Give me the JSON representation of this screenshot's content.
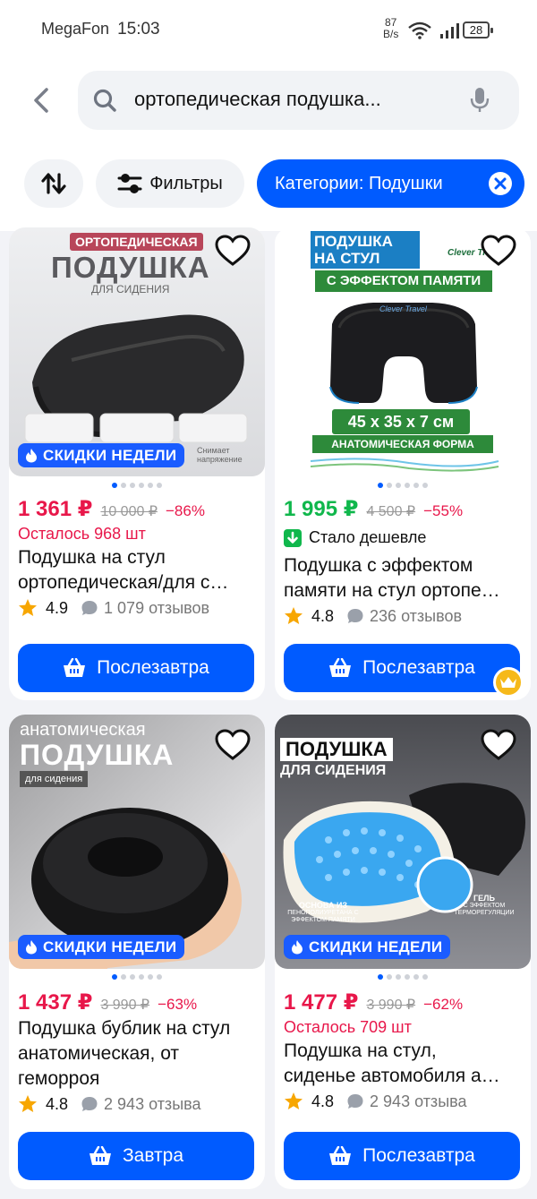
{
  "status_bar": {
    "carrier": "MegaFon",
    "time": "15:03",
    "net_speed_value": "87",
    "net_speed_unit": "B/s",
    "battery": "28"
  },
  "search": {
    "query": "ортопедическая подушка..."
  },
  "chips": {
    "filters_label": "Фильтры",
    "category_label": "Категории: Подушки"
  },
  "colors": {
    "accent": "#005bff",
    "price_red": "#e8174a",
    "price_green": "#10b74c",
    "badge": "#1a5cff"
  },
  "products": [
    {
      "image_text": {
        "top": "ОРТОПЕДИЧЕСКАЯ",
        "main": "ПОДУШКА",
        "sub": "ДЛЯ СИДЕНИЯ",
        "tag": "Снимает напряжение"
      },
      "badge": "СКИДКИ НЕДЕЛИ",
      "price": "1 361 ₽",
      "old_price": "10 000 ₽",
      "discount": "−86%",
      "note": "Осталось 968 шт",
      "title_line1": "Подушка на стул",
      "title_line2": "ортопедическая/для с…",
      "rating": "4.9",
      "reviews": "1 079 отзывов",
      "delivery": "Послезавтра"
    },
    {
      "image_text": {
        "line1": "ПОДУШКА",
        "line2": "НА СТУЛ",
        "brand": "Clever Travel",
        "effect": "С ЭФФЕКТОМ ПАМЯТИ",
        "product_brand": "Clever Travel",
        "size": "45 x 35 x 7 см",
        "form": "АНАТОМИЧЕСКАЯ ФОРМА"
      },
      "price": "1 995 ₽",
      "old_price": "4 500 ₽",
      "discount": "−55%",
      "note": "Стало дешевле",
      "title_line1": "Подушка с эффектом",
      "title_line2": "памяти на стул ортопе…",
      "rating": "4.8",
      "reviews": "236 отзывов",
      "delivery": "Послезавтра"
    },
    {
      "image_text": {
        "top": "анатомическая",
        "main": "ПОДУШКА",
        "sub": "для сидения"
      },
      "badge": "СКИДКИ НЕДЕЛИ",
      "price": "1 437 ₽",
      "old_price": "3 990 ₽",
      "discount": "−63%",
      "title_line1": "Подушка бублик на стул",
      "title_line2": "анатомическая, от",
      "title_line3": "геморроя",
      "rating": "4.8",
      "reviews": "2 943 отзыва",
      "delivery": "Завтра"
    },
    {
      "image_text": {
        "main": "ПОДУШКА",
        "sub": "ДЛЯ СИДЕНИЯ",
        "base_title": "ОСНОВА ИЗ",
        "base_desc": "ПЕНОПОЛИУРЕТАНА С ЭФФЕКТОМ ПАМЯТИ",
        "gel_title": "ГЕЛЬ",
        "gel_desc": "С ЭФФЕКТОМ ТЕРМОРЕГУЛЯЦИИ"
      },
      "badge": "СКИДКИ НЕДЕЛИ",
      "price": "1 477 ₽",
      "old_price": "3 990 ₽",
      "discount": "−62%",
      "note": "Осталось 709 шт",
      "title_line1": "Подушка на стул,",
      "title_line2": "сиденье автомобиля а…",
      "rating": "4.8",
      "reviews": "2 943 отзыва",
      "delivery": "Послезавтра"
    }
  ]
}
